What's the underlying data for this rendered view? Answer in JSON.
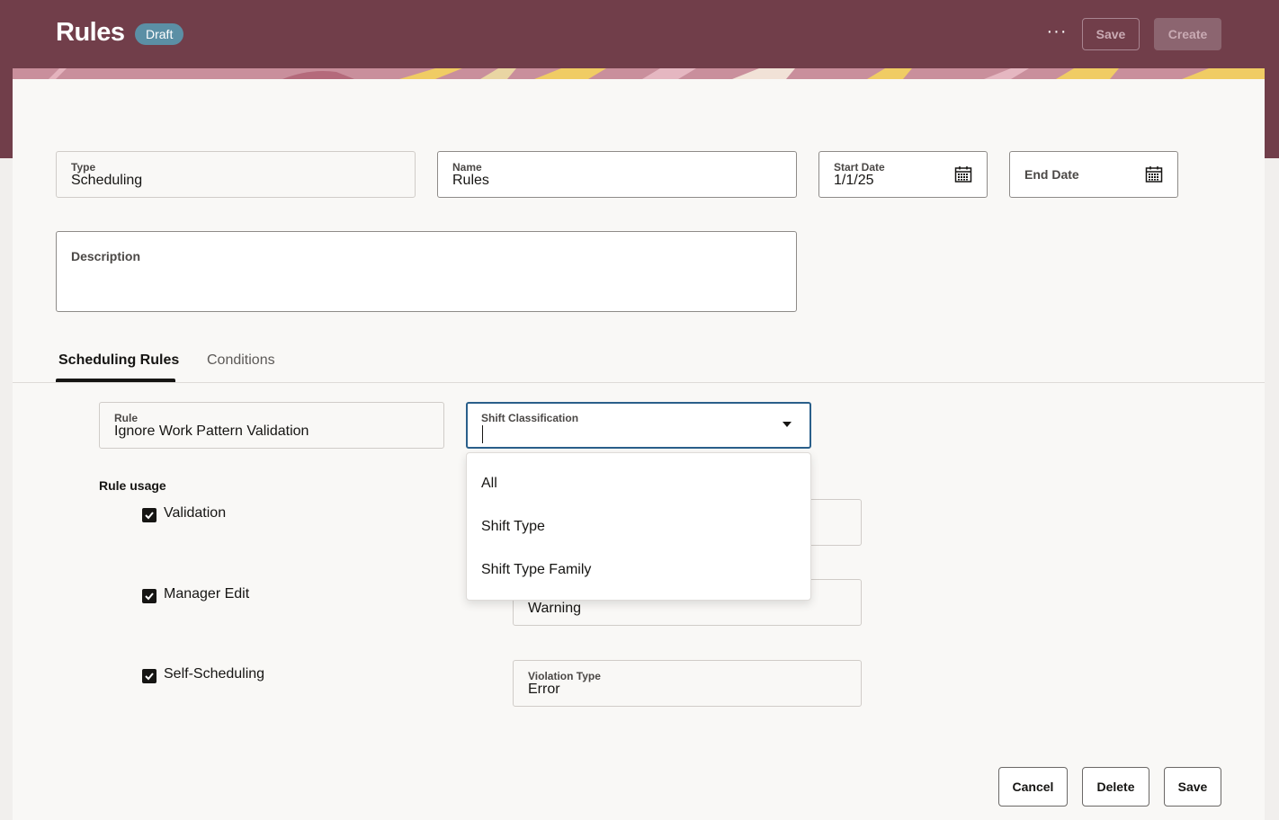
{
  "header": {
    "title": "Rules",
    "status_badge": "Draft",
    "more_label": "···",
    "save_label": "Save",
    "create_label": "Create",
    "banner_color": "#713e4a"
  },
  "form": {
    "type": {
      "label": "Type",
      "value": "Scheduling"
    },
    "name": {
      "label": "Name",
      "value": "Rules"
    },
    "start_date": {
      "label": "Start Date",
      "value": "1/1/25"
    },
    "end_date": {
      "placeholder": "End Date"
    },
    "description": {
      "label": "Description",
      "value": ""
    }
  },
  "tabs": [
    {
      "label": "Scheduling Rules",
      "selected": true
    },
    {
      "label": "Conditions",
      "selected": false
    }
  ],
  "rule_section": {
    "rule": {
      "label": "Rule",
      "value": "Ignore Work Pattern Validation"
    },
    "shift_classification": {
      "label": "Shift Classification",
      "value": ""
    },
    "rule_usage_label": "Rule usage",
    "usages": [
      {
        "label": "Validation",
        "checked": true
      },
      {
        "label": "Manager Edit",
        "checked": true
      },
      {
        "label": "Self-Scheduling",
        "checked": true
      }
    ],
    "manager_edit_violation": {
      "value": "Warning"
    },
    "self_scheduling_violation": {
      "label": "Violation Type",
      "value": "Error"
    }
  },
  "dropdown": {
    "options": [
      "All",
      "Shift Type",
      "Shift Type Family"
    ]
  },
  "footer": {
    "cancel_label": "Cancel",
    "delete_label": "Delete",
    "save_label": "Save"
  }
}
